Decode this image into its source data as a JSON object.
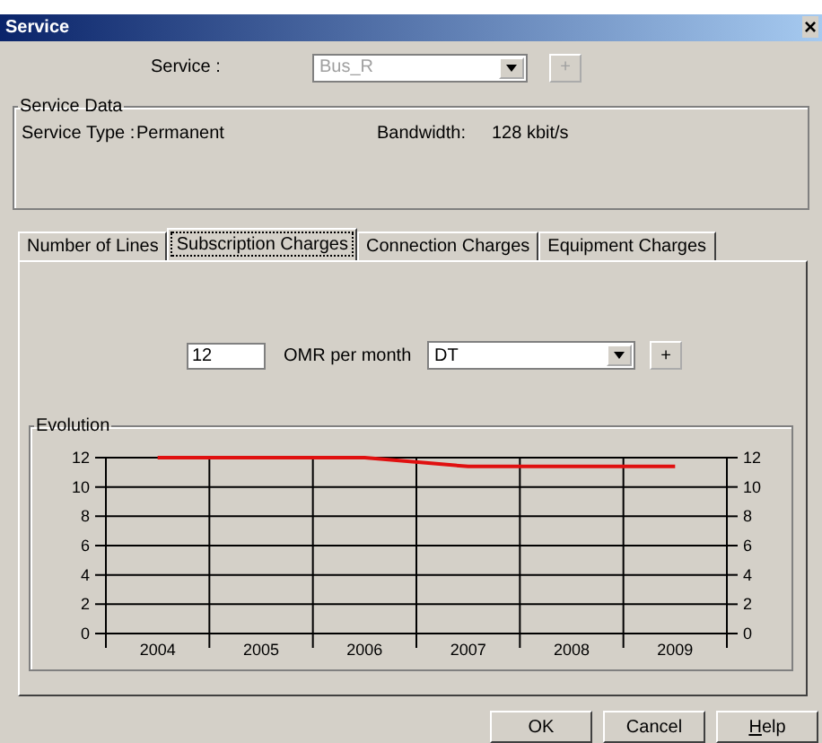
{
  "window": {
    "title": "Service",
    "close": "×"
  },
  "service": {
    "label": "Service :",
    "value": "Bus_R",
    "disabled": true,
    "add": "+"
  },
  "service_data": {
    "title": "Service Data",
    "fields": [
      {
        "label": "Service Type :",
        "value": "Permanent"
      },
      {
        "label": "Bandwidth:",
        "value": "128 kbit/s"
      }
    ]
  },
  "tabs": [
    {
      "label": "Number of Lines",
      "selected": false
    },
    {
      "label": "Subscription Charges",
      "selected": true
    },
    {
      "label": "Connection Charges",
      "selected": false
    },
    {
      "label": "Equipment Charges",
      "selected": false
    }
  ],
  "charge": {
    "value": "12",
    "unit": "OMR per month",
    "currency": "DT",
    "add": "+"
  },
  "evolution": {
    "title": "Evolution",
    "chart_data": {
      "type": "line",
      "categories": [
        "2004",
        "2005",
        "2006",
        "2007",
        "2008",
        "2009"
      ],
      "series": [
        {
          "color": "#e01010",
          "values": [
            12,
            12,
            12,
            11.4,
            11.4,
            11.4
          ]
        }
      ],
      "ylim": [
        0,
        12
      ],
      "yticks": [
        0,
        2,
        4,
        6,
        8,
        10,
        12
      ],
      "y2lim": [
        0,
        12
      ],
      "y2ticks": [
        0,
        2,
        4,
        6,
        8,
        10,
        12
      ],
      "grid": true
    }
  },
  "buttons": [
    {
      "label": "OK"
    },
    {
      "label": "Cancel"
    },
    {
      "label": "Help"
    }
  ]
}
